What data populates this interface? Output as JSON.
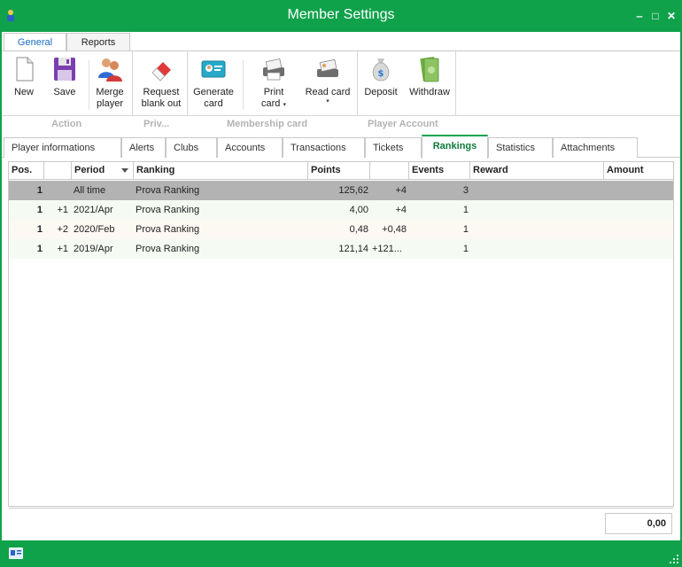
{
  "window": {
    "title": "Member Settings",
    "minimize": "‒",
    "maximize": "□",
    "close": "✕"
  },
  "ribbon_tabs": [
    "General",
    "Reports"
  ],
  "ribbon": {
    "new": "New",
    "save": "Save",
    "merge_l1": "Merge",
    "merge_l2": "player",
    "request_l1": "Request",
    "request_l2": "blank out",
    "generate_l1": "Generate",
    "generate_l2": "card",
    "print_l1": "Print",
    "print_l2": "card",
    "read_l1": "Read card",
    "deposit": "Deposit",
    "withdraw": "Withdraw",
    "dropdown": "▾"
  },
  "groups": [
    "Action",
    "Priv...",
    "Membership card",
    "Player Account"
  ],
  "page_tabs": [
    "Player informations",
    "Alerts",
    "Clubs",
    "Accounts",
    "Transactions",
    "Tickets",
    "Rankings",
    "Statistics",
    "Attachments"
  ],
  "grid": {
    "columns": [
      "Pos.",
      "",
      "Period",
      "Ranking",
      "Points",
      "",
      "Events",
      "Reward",
      "Amount"
    ],
    "rows": [
      {
        "pos": "1",
        "change": "",
        "period": "All time",
        "ranking": "Prova Ranking",
        "points": "125,62",
        "points_delta": "+4",
        "events": "3"
      },
      {
        "pos": "1",
        "change": "+1",
        "period": "2021/Apr",
        "ranking": "Prova Ranking",
        "points": "4,00",
        "points_delta": "+4",
        "events": "1"
      },
      {
        "pos": "1",
        "change": "+2",
        "period": "2020/Feb",
        "ranking": "Prova Ranking",
        "points": "0,48",
        "points_delta": "+0,48",
        "events": "1"
      },
      {
        "pos": "1",
        "change": "+1",
        "period": "2019/Apr",
        "ranking": "Prova Ranking",
        "points": "121,14",
        "points_delta": "+121...",
        "events": "1"
      }
    ],
    "total": "0,00"
  },
  "colors": {
    "accent": "#0fa24b",
    "selected_row": "#b3b3b3",
    "group_label": "#b3b3b3"
  }
}
